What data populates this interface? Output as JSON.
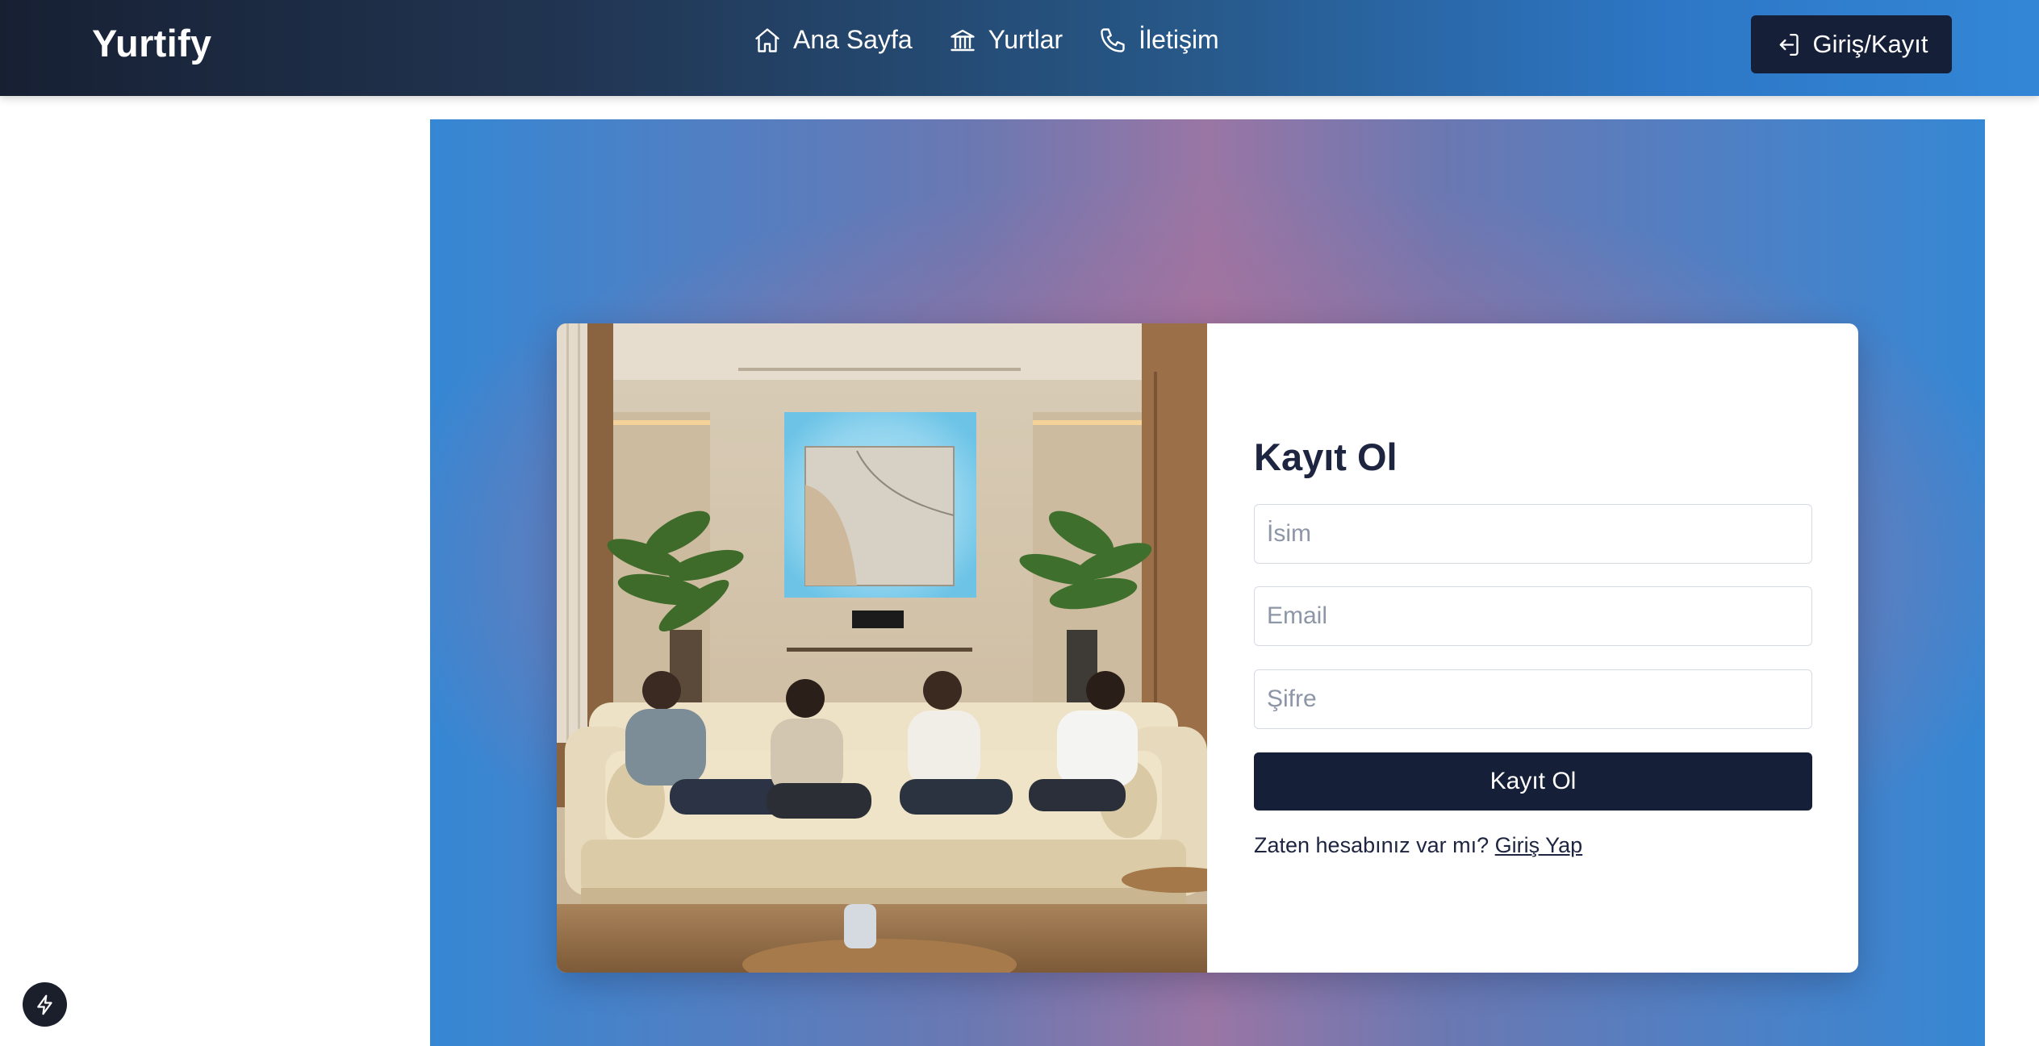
{
  "header": {
    "brand": "Yurtify",
    "nav": [
      {
        "label": "Ana Sayfa",
        "icon": "home-icon"
      },
      {
        "label": "Yurtlar",
        "icon": "bank-icon"
      },
      {
        "label": "İletişim",
        "icon": "phone-icon"
      }
    ],
    "auth_button": {
      "label": "Giriş/Kayıt",
      "icon": "log-in-icon"
    }
  },
  "register_form": {
    "title": "Kayıt Ol",
    "name_field": {
      "placeholder": "İsim",
      "value": ""
    },
    "email_field": {
      "placeholder": "Email",
      "value": ""
    },
    "password_field": {
      "placeholder": "Şifre",
      "value": ""
    },
    "submit_label": "Kayıt Ol",
    "login_prompt": "Zaten hesabınız var mı?",
    "login_link": "Giriş Yap"
  },
  "hero_image": {
    "subject": "illustration",
    "alt": ""
  },
  "floating_button": {
    "icon": "bolt-icon"
  },
  "colors": {
    "header_gradient_start": "#172033",
    "header_gradient_end": "#3386d6",
    "primary_button": "#161f38",
    "hero_blue": "#3587d4",
    "hero_pink": "#cd6c8c",
    "title_text": "#1e2540"
  }
}
